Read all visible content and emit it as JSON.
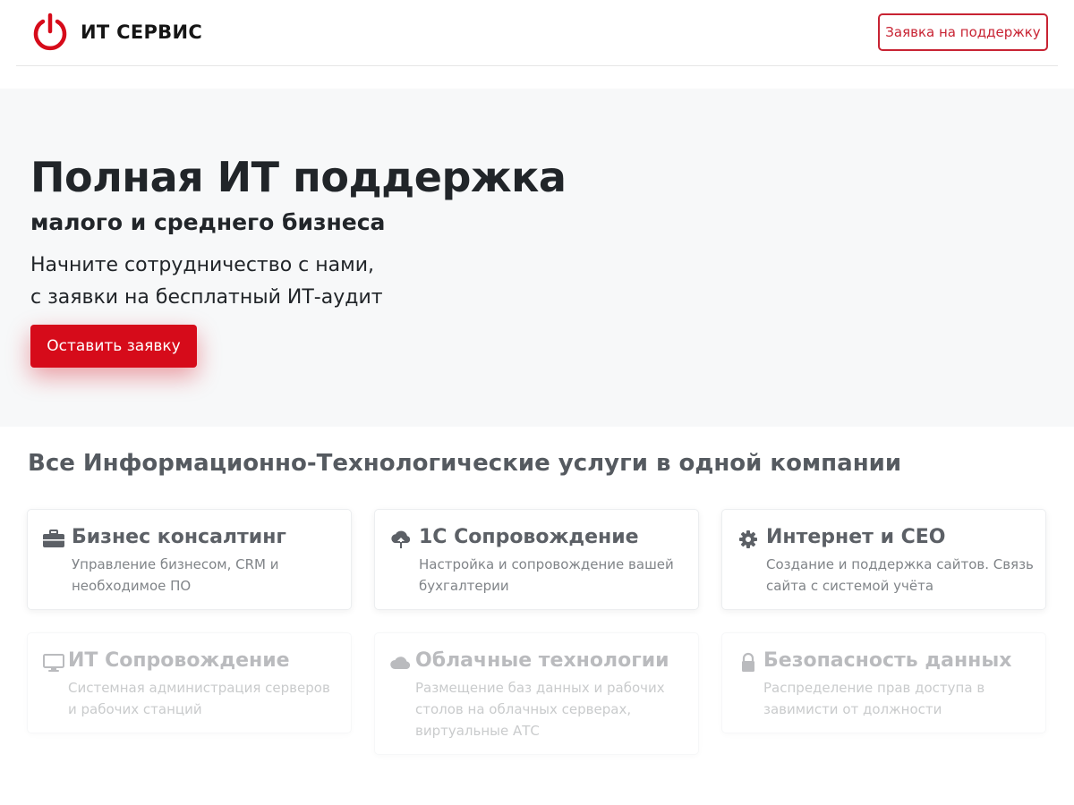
{
  "header": {
    "brand": "ИТ СЕРВИС",
    "support_button": "Заявка на поддержку"
  },
  "hero": {
    "title": "Полная ИТ поддержка",
    "subtitle": "малого и среднего бизнеса",
    "line1": "Начните сотрудничество с нами,",
    "line2": "с заявки на бесплатный ИТ-аудит",
    "cta_button": "Оставить заявку"
  },
  "services": {
    "heading": "Все Информационно-Технологические услуги в одной компании",
    "items": [
      {
        "icon": "briefcase-icon",
        "title": "Бизнес консалтинг",
        "desc": "Управление бизнесом, CRM и необходимое ПО"
      },
      {
        "icon": "cloud-upload-icon",
        "title": "1С Сопровождение",
        "desc": "Настройка и сопровождение вашей бухгалтерии"
      },
      {
        "icon": "gear-icon",
        "title": "Интернет и СЕО",
        "desc": "Создание и поддержка сайтов. Связь сайта с системой учёта"
      },
      {
        "icon": "monitor-icon",
        "title": "ИТ Сопровождение",
        "desc": "Системная администрация серверов и рабочих станций"
      },
      {
        "icon": "cloud-icon",
        "title": "Облачные технологии",
        "desc": "Размещение баз данных и рабочих столов на облачных серверах, виртуальные АТС"
      },
      {
        "icon": "lock-icon",
        "title": "Безопасность данных",
        "desc": "Распределение прав доступа в завимисти от должности"
      }
    ]
  },
  "colors": {
    "accent": "#d60b1a",
    "outline": "#c82333",
    "hero_bg": "#f7f8f9"
  }
}
